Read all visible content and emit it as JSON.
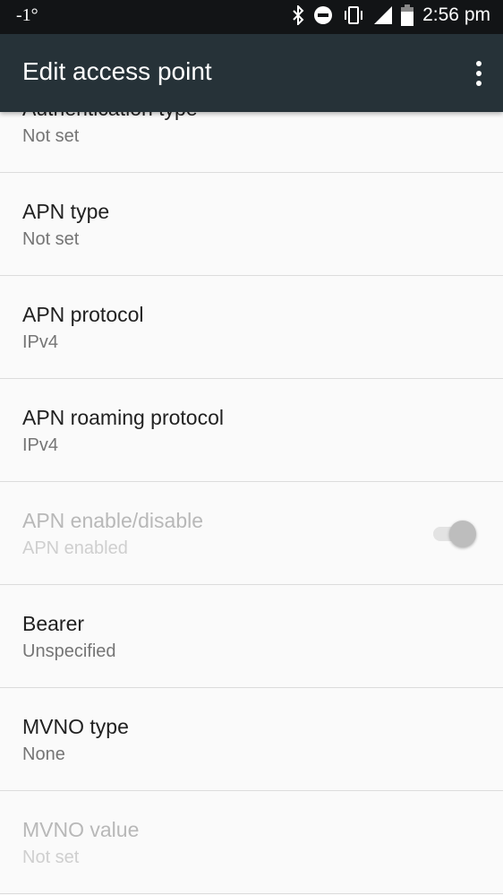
{
  "status_bar": {
    "left": "-1°",
    "time": "2:56 pm",
    "icons": [
      "bluetooth-icon",
      "dnd-icon",
      "vibrate-icon",
      "signal-icon",
      "battery-icon"
    ]
  },
  "toolbar": {
    "title": "Edit access point",
    "menu_icon": "more-vert-icon"
  },
  "items": [
    {
      "title": "Authentication type",
      "summary": "Not set"
    },
    {
      "title": "APN type",
      "summary": "Not set"
    },
    {
      "title": "APN protocol",
      "summary": "IPv4"
    },
    {
      "title": "APN roaming protocol",
      "summary": "IPv4"
    },
    {
      "title": "APN enable/disable",
      "summary": "APN enabled",
      "disabled": true,
      "switch_on": true
    },
    {
      "title": "Bearer",
      "summary": "Unspecified"
    },
    {
      "title": "MVNO type",
      "summary": "None"
    },
    {
      "title": "MVNO value",
      "summary": "Not set",
      "disabled": true
    }
  ]
}
